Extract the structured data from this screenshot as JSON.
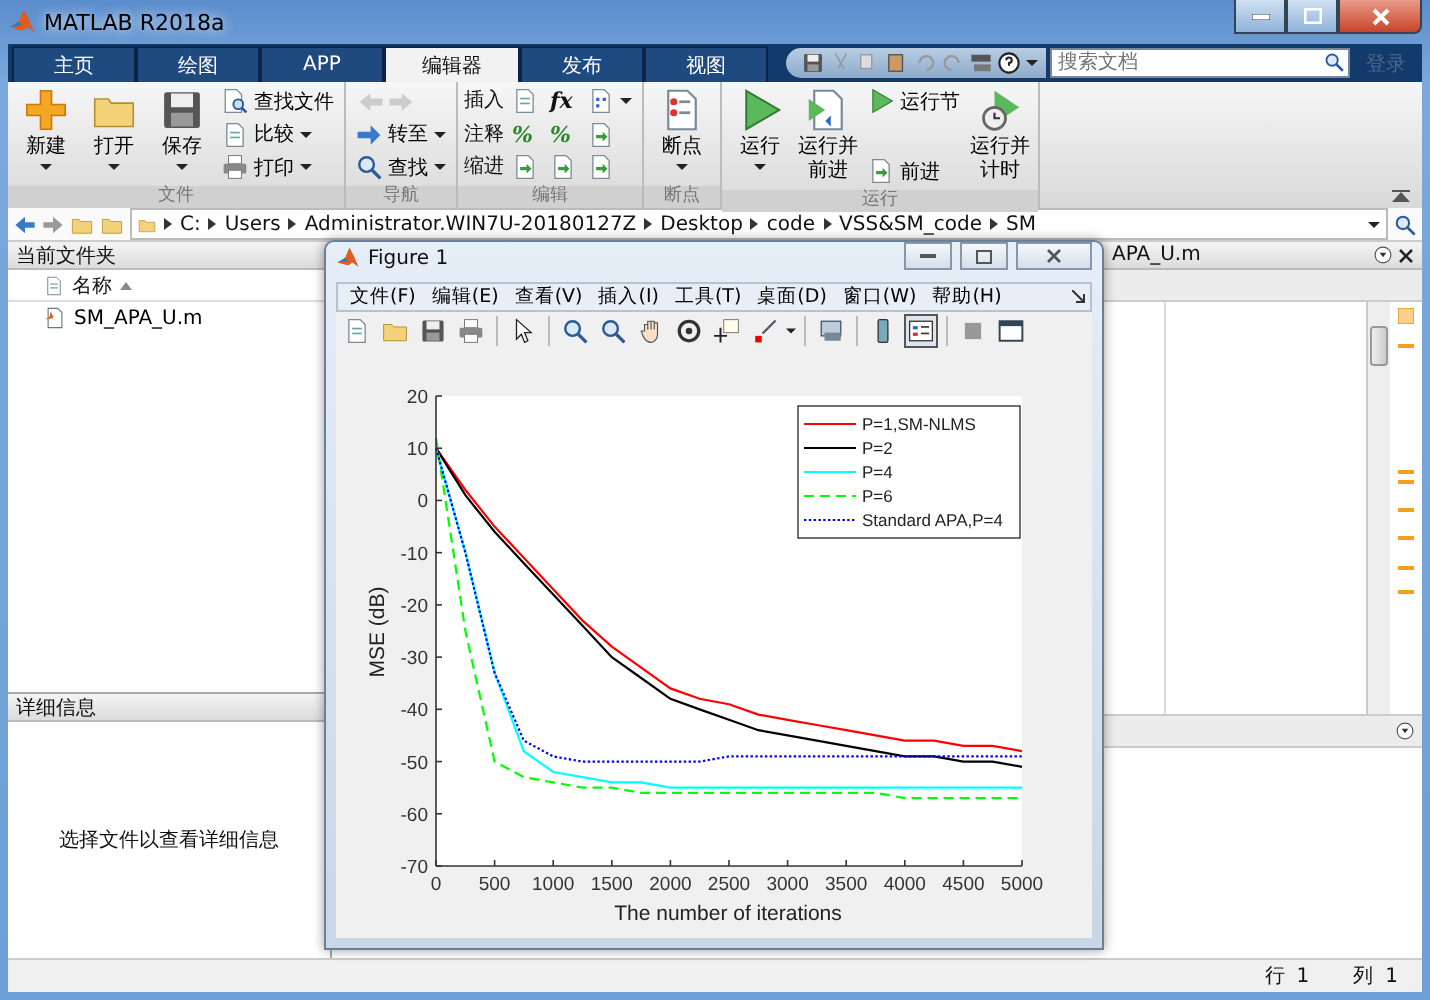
{
  "window": {
    "title": "MATLAB R2018a"
  },
  "tabs": [
    {
      "label": "主页",
      "selected": false
    },
    {
      "label": "绘图",
      "selected": false
    },
    {
      "label": "APP",
      "selected": false
    },
    {
      "label": "编辑器",
      "selected": true
    },
    {
      "label": "发布",
      "selected": false
    },
    {
      "label": "视图",
      "selected": false
    }
  ],
  "search": {
    "placeholder": "搜索文档"
  },
  "login": "登录",
  "ribbon": [
    {
      "label": "文件",
      "columns": [
        [
          {
            "kind": "large",
            "label": "新建",
            "menu": true
          }
        ],
        [
          {
            "kind": "large",
            "label": "打开",
            "menu": true
          }
        ],
        [
          {
            "kind": "large",
            "label": "保存",
            "menu": true
          }
        ],
        [
          {
            "kind": "small",
            "label": "查找文件",
            "menu": false
          },
          {
            "kind": "small",
            "label": "比较",
            "menu": true
          },
          {
            "kind": "small",
            "label": "打印",
            "menu": true
          }
        ]
      ]
    },
    {
      "label": "导航",
      "columns": [
        [
          {
            "kind": "icons",
            "disabled": true
          },
          {
            "kind": "small",
            "label": "转至",
            "menu": true
          },
          {
            "kind": "small",
            "label": "查找",
            "menu": true
          }
        ]
      ]
    },
    {
      "label": "编辑",
      "columns": [
        [
          {
            "kind": "text",
            "label": "插入"
          },
          {
            "kind": "text",
            "label": "注释"
          },
          {
            "kind": "text",
            "label": "缩进"
          }
        ],
        [
          {
            "kind": "icon",
            "menu": false
          },
          {
            "kind": "glyph",
            "label": "%",
            "menu": false
          },
          {
            "kind": "icon",
            "menu": false
          }
        ],
        [
          {
            "kind": "glyph",
            "label": "fx",
            "menu": false
          },
          {
            "kind": "glyph",
            "label": "%",
            "menu": false
          },
          {
            "kind": "icon",
            "menu": false
          }
        ],
        [
          {
            "kind": "icon",
            "menu": true
          },
          {
            "kind": "icon",
            "menu": false
          },
          {
            "kind": "icon",
            "menu": false
          }
        ]
      ]
    },
    {
      "label": "断点",
      "columns": [
        [
          {
            "kind": "large",
            "label": "断点",
            "menu": true
          }
        ]
      ]
    },
    {
      "label": "运行",
      "columns": [
        [
          {
            "kind": "large",
            "label": "运行",
            "menu": true
          }
        ],
        [
          {
            "kind": "large",
            "label": "运行并前进",
            "menu": false
          }
        ],
        [
          {
            "kind": "small",
            "label": "运行节",
            "menu": false
          },
          {
            "kind": "small",
            "label": "前进",
            "menu": false
          }
        ],
        [
          {
            "kind": "large",
            "label": "运行并计时",
            "menu": false
          }
        ]
      ]
    }
  ],
  "path": [
    "C:",
    "Users",
    "Administrator.WIN7U-20180127Z",
    "Desktop",
    "code",
    "VSS&SM_code",
    "SM"
  ],
  "current_folder": {
    "title": "当前文件夹",
    "column": "名称",
    "files": [
      "SM_APA_U.m"
    ]
  },
  "details": {
    "title": "详细信息",
    "message": "选择文件以查看详细信息"
  },
  "editor": {
    "tab": "APA_U.m"
  },
  "figure": {
    "title": "Figure 1",
    "menus": [
      "文件(F)",
      "编辑(E)",
      "查看(V)",
      "插入(I)",
      "工具(T)",
      "桌面(D)",
      "窗口(W)",
      "帮助(H)"
    ],
    "toolbar": [
      {
        "pressed": false
      },
      {
        "pressed": false
      },
      {
        "pressed": false
      },
      {
        "pressed": false
      },
      {
        "pressed": false
      },
      {
        "pressed": false
      },
      {
        "pressed": false
      },
      {
        "pressed": false
      },
      {
        "pressed": false
      },
      {
        "pressed": false
      },
      {
        "pressed": false
      },
      {
        "pressed": false
      },
      {
        "pressed": false
      },
      {
        "pressed": true
      },
      {
        "pressed": false
      },
      {
        "pressed": false
      }
    ],
    "chart_data": {
      "type": "line",
      "legend": true,
      "xlabel": "The number of iterations",
      "ylabel": "MSE (dB)",
      "x": [
        0,
        250,
        500,
        750,
        1000,
        1250,
        1500,
        1750,
        2000,
        2250,
        2500,
        2750,
        3000,
        3250,
        3500,
        3750,
        4000,
        4250,
        4500,
        4750,
        5000
      ],
      "series": [
        {
          "name": "P=1,SM-NLMS",
          "color": "#ff0000",
          "line_style": "solid",
          "values": [
            10,
            2,
            -5,
            -11,
            -17,
            -23,
            -28,
            -32,
            -36,
            -38,
            -39,
            -41,
            -42,
            -43,
            -44,
            -45,
            -46,
            -46,
            -47,
            -47,
            -48
          ]
        },
        {
          "name": "P=2",
          "color": "#000000",
          "line_style": "solid",
          "values": [
            10,
            1,
            -6,
            -12,
            -18,
            -24,
            -30,
            -34,
            -38,
            -40,
            -42,
            -44,
            -45,
            -46,
            -47,
            -48,
            -49,
            -49,
            -50,
            -50,
            -51
          ]
        },
        {
          "name": "P=4",
          "color": "#00ffff",
          "line_style": "solid",
          "values": [
            10,
            -10,
            -33,
            -48,
            -52,
            -53,
            -54,
            -54,
            -55,
            -55,
            -55,
            -55,
            -55,
            -55,
            -55,
            -55,
            -55,
            -55,
            -55,
            -55,
            -55
          ]
        },
        {
          "name": "P=6",
          "color": "#00ff00",
          "line_style": "dashed",
          "values": [
            12,
            -25,
            -50,
            -53,
            -54,
            -55,
            -55,
            -56,
            -56,
            -56,
            -56,
            -56,
            -56,
            -56,
            -56,
            -56,
            -57,
            -57,
            -57,
            -57,
            -57
          ]
        },
        {
          "name": "Standard APA,P=4",
          "color": "#0000ff",
          "line_style": "dotted",
          "values": [
            10,
            -10,
            -33,
            -46,
            -49,
            -50,
            -50,
            -50,
            -50,
            -50,
            -49,
            -49,
            -49,
            -49,
            -49,
            -49,
            -49,
            -49,
            -49,
            -49,
            -49
          ]
        }
      ],
      "xlim": [
        0,
        5000
      ],
      "ylim": [
        -70,
        20
      ],
      "xticks": [
        0,
        500,
        1000,
        1500,
        2000,
        2500,
        3000,
        3500,
        4000,
        4500,
        5000
      ],
      "yticks": [
        -70,
        -60,
        -50,
        -40,
        -30,
        -20,
        -10,
        0,
        10,
        20
      ]
    }
  },
  "status_bar": {
    "row_label": "行",
    "row": "1",
    "col_label": "列",
    "col": "1"
  }
}
